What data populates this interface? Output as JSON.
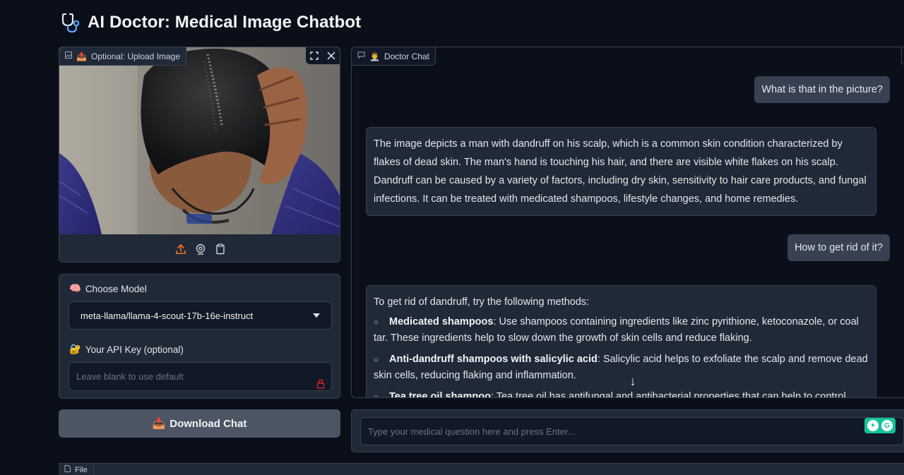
{
  "app": {
    "title": "AI Doctor: Medical Image Chatbot"
  },
  "image_panel": {
    "label": "Optional: Upload Image",
    "label_emoji": "📤"
  },
  "model": {
    "label": "Choose Model",
    "label_emoji": "🧠",
    "selected": "meta-llama/llama-4-scout-17b-16e-instruct"
  },
  "api_key": {
    "label": "Your API Key (optional)",
    "label_emoji": "🔐",
    "placeholder": "Leave blank to use default"
  },
  "download": {
    "label": "Download Chat",
    "emoji": "📥"
  },
  "chat": {
    "label": "Doctor Chat",
    "label_emoji": "👨‍⚕️",
    "messages": [
      {
        "role": "user",
        "text": "What is that in the picture?"
      },
      {
        "role": "bot",
        "text": "The image depicts a man with dandruff on his scalp, which is a common skin condition characterized by flakes of dead skin. The man's hand is touching his hair, and there are visible white flakes on his scalp. Dandruff can be caused by a variety of factors, including dry skin, sensitivity to hair care products, and fungal infections. It can be treated with medicated shampoos, lifestyle changes, and home remedies."
      },
      {
        "role": "user",
        "text": "How to get rid of it?"
      },
      {
        "role": "bot",
        "intro": "To get rid of dandruff, try the following methods:",
        "items": [
          {
            "bold": "Medicated shampoos",
            "rest": ": Use shampoos containing ingredients like zinc pyrithione, ketoconazole, or coal tar. These ingredients help to slow down the growth of skin cells and reduce flaking."
          },
          {
            "bold": "Anti-dandruff shampoos with salicylic acid",
            "rest": ": Salicylic acid helps to exfoliate the scalp and remove dead skin cells, reducing flaking and inflammation."
          },
          {
            "bold": "Tea tree oil shampoo",
            "rest": ": Tea tree oil has antifungal and antibacterial properties that can help to control"
          }
        ]
      }
    ]
  },
  "chat_input": {
    "placeholder": "Type your medical question here and press Enter..."
  },
  "file_panel": {
    "label": "File"
  },
  "colors": {
    "background": "#0b0f19",
    "panel": "#1f2937",
    "border": "#374151",
    "accent_orange": "#f97316",
    "grammarly": "#15c39a"
  }
}
